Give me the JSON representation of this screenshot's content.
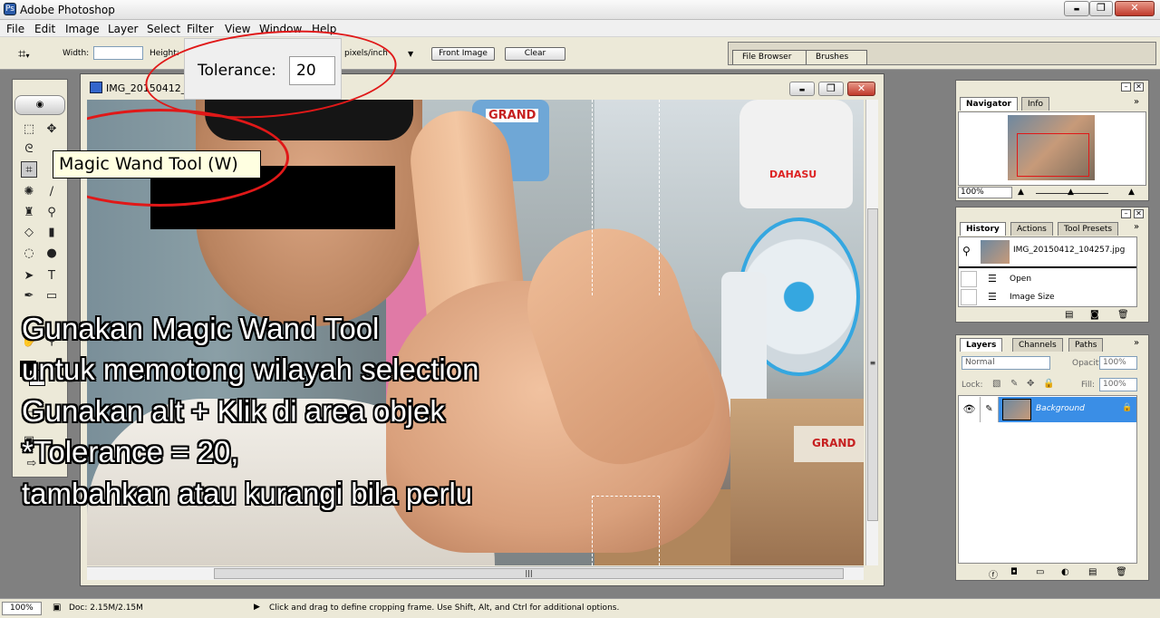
{
  "app": {
    "title": "Adobe Photoshop"
  },
  "window_controls": {
    "minimize": "▬",
    "maximize": "❐",
    "close": "✕"
  },
  "menu": [
    "File",
    "Edit",
    "Image",
    "Layer",
    "Select",
    "Filter",
    "View",
    "Window",
    "Help"
  ],
  "options": {
    "width_label": "Width:",
    "height_label": "Height:",
    "units": "pixels/inch",
    "front_image": "Front Image",
    "clear": "Clear",
    "well_tabs": [
      "File Browser",
      "Brushes"
    ]
  },
  "tolerance_callout": {
    "label": "Tolerance:",
    "value": "20"
  },
  "tooltip": "Magic Wand Tool (W)",
  "document": {
    "title": "IMG_20150412_1"
  },
  "overlay_text": [
    "Gunakan Magic Wand Tool",
    "untuk memotong wilayah selection",
    "Gunakan alt + Klik di area objek",
    "*Tolerance = 20,",
    "tambahkan atau kurangi bila perlu"
  ],
  "photo_signs": {
    "shop_top": "GRAND",
    "bag": "DAHASU",
    "box": "GRAND"
  },
  "navigator": {
    "tabs": [
      "Navigator",
      "Info"
    ],
    "zoom": "100%"
  },
  "history": {
    "tabs": [
      "History",
      "Actions",
      "Tool Presets"
    ],
    "snapshot": "IMG_20150412_104257.jpg",
    "items": [
      "Open",
      "Image Size"
    ]
  },
  "layers": {
    "tabs": [
      "Layers",
      "Channels",
      "Paths"
    ],
    "blend_mode": "Normal",
    "opacity_label": "Opacity:",
    "opacity": "100%",
    "lock_label": "Lock:",
    "fill_label": "Fill:",
    "fill": "100%",
    "layer_name": "Background"
  },
  "status": {
    "zoom": "100%",
    "doc": "Doc: 2.15M/2.15M",
    "hint": "Click and drag to define cropping frame. Use Shift, Alt, and Ctrl for additional options."
  },
  "colors": {
    "annotation": "#e01818",
    "selected_layer": "#3a8ee6",
    "chrome": "#ece9d8"
  }
}
